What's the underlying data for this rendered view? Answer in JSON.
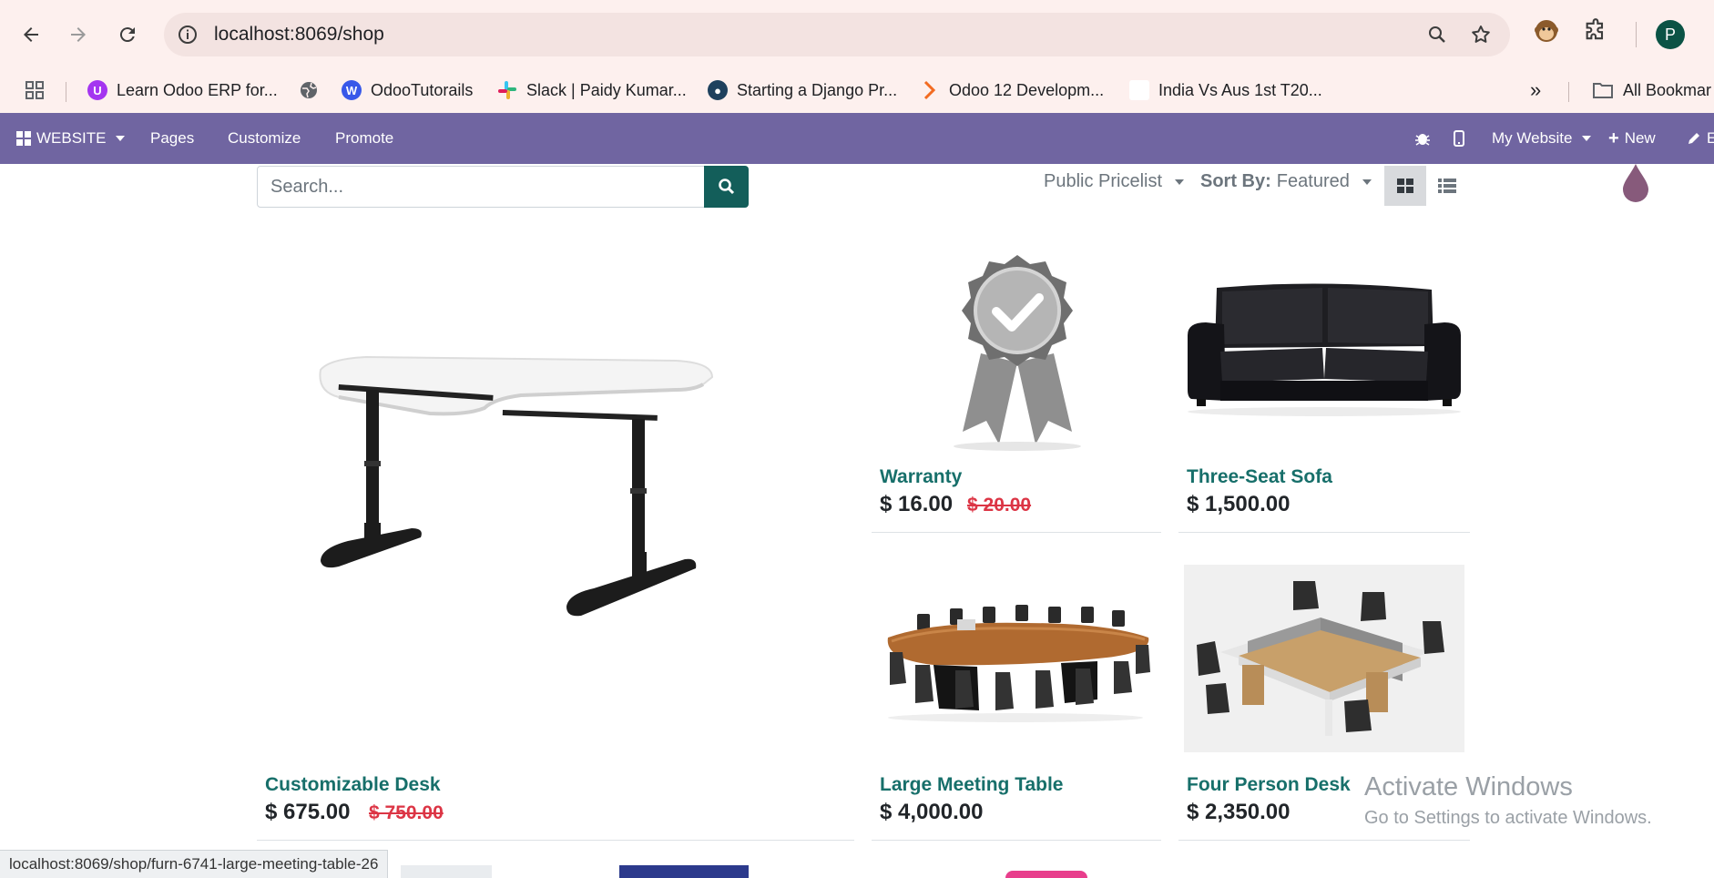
{
  "browser": {
    "url_host": "localhost",
    "url_rest": ":8069/shop",
    "avatar_letter": "P",
    "bookmarks": [
      {
        "label": "Learn Odoo ERP for...",
        "icon": "udemy-icon"
      },
      {
        "label": "",
        "icon": "globe-icon"
      },
      {
        "label": "OdooTutorails",
        "icon": "wordpress-icon"
      },
      {
        "label": "Slack | Paidy Kumar...",
        "icon": "slack-icon"
      },
      {
        "label": "Starting a Django Pr...",
        "icon": "python-icon"
      },
      {
        "label": "Odoo 12 Developm...",
        "icon": "chevron-right-icon"
      },
      {
        "label": "India Vs Aus 1st T20...",
        "icon": "blank-page-icon"
      }
    ],
    "all_bookmarks": "All Bookmar"
  },
  "odoo_bar": {
    "website": "WEBSITE",
    "pages": "Pages",
    "customize": "Customize",
    "promote": "Promote",
    "my_website": "My Website",
    "new": "New",
    "edit": "E"
  },
  "shop": {
    "search_placeholder": "Search...",
    "pricelist": "Public Pricelist",
    "sort_label": "Sort By:",
    "sort_value": "Featured"
  },
  "products": [
    {
      "name": "Customizable Desk",
      "price": "$ 675.00",
      "old_price": "$ 750.00"
    },
    {
      "name": "Warranty",
      "price": "$ 16.00",
      "old_price": "$ 20.00"
    },
    {
      "name": "Three-Seat Sofa",
      "price": "$ 1,500.00",
      "old_price": ""
    },
    {
      "name": "Large Meeting Table",
      "price": "$ 4,000.00",
      "old_price": ""
    },
    {
      "name": "Four Person Desk",
      "price": "$ 2,350.00",
      "old_price": ""
    }
  ],
  "status_bar": "localhost:8069/shop/furn-6741-large-meeting-table-26",
  "watermark": {
    "line1": "Activate Windows",
    "line2": "Go to Settings to activate Windows."
  },
  "colors": {
    "odoo_bar": "#7065a1",
    "product_name": "#176f6a",
    "old_price": "#dc3545",
    "search_button": "#135e5a"
  }
}
